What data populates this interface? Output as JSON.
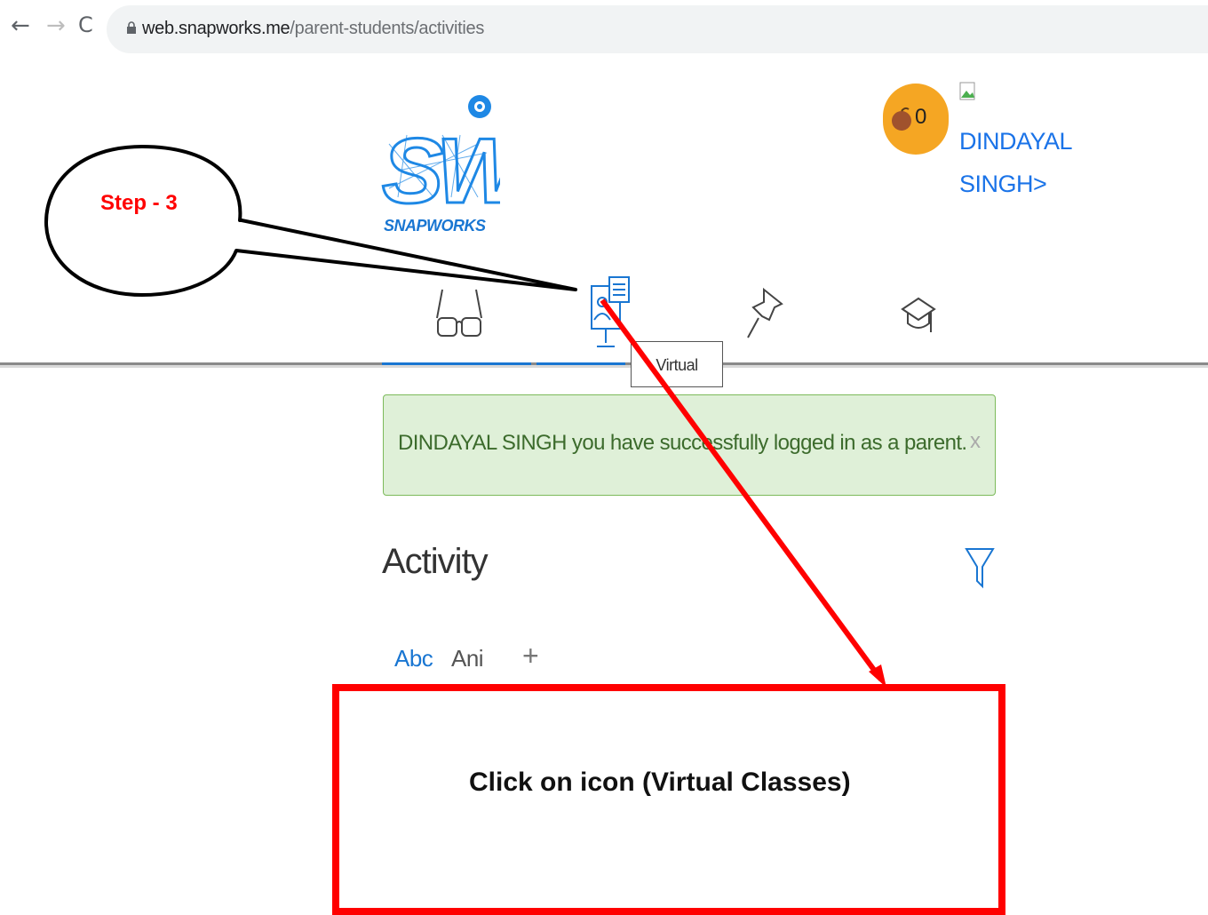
{
  "browser": {
    "back": "←",
    "forward": "→",
    "reload": "C",
    "url_host": "web.snapworks.me",
    "url_path": "/parent-students/activities"
  },
  "header": {
    "logo_text": "SNAPWORKS",
    "points": "0",
    "user_name": "DINDAYAL SINGH>"
  },
  "tabs": [
    {
      "name": "glasses-icon"
    },
    {
      "name": "virtual-classes-icon",
      "tooltip": "Virtual Classes"
    },
    {
      "name": "pin-icon"
    },
    {
      "name": "graduation-cap-icon"
    }
  ],
  "alert": {
    "message": "DINDAYAL SINGH you have successfully logged in as a parent.",
    "close": "x"
  },
  "activity": {
    "title": "Activity",
    "chips": [
      "Abc",
      "Ani"
    ],
    "add": "+"
  },
  "annotations": {
    "step": "Step - 3",
    "instruction": "Click on icon (Virtual Classes)"
  },
  "colors": {
    "accent": "#1976d2",
    "points_bg": "#f5a623",
    "alert_bg": "#dff0d8",
    "annotation": "#ff0000"
  }
}
